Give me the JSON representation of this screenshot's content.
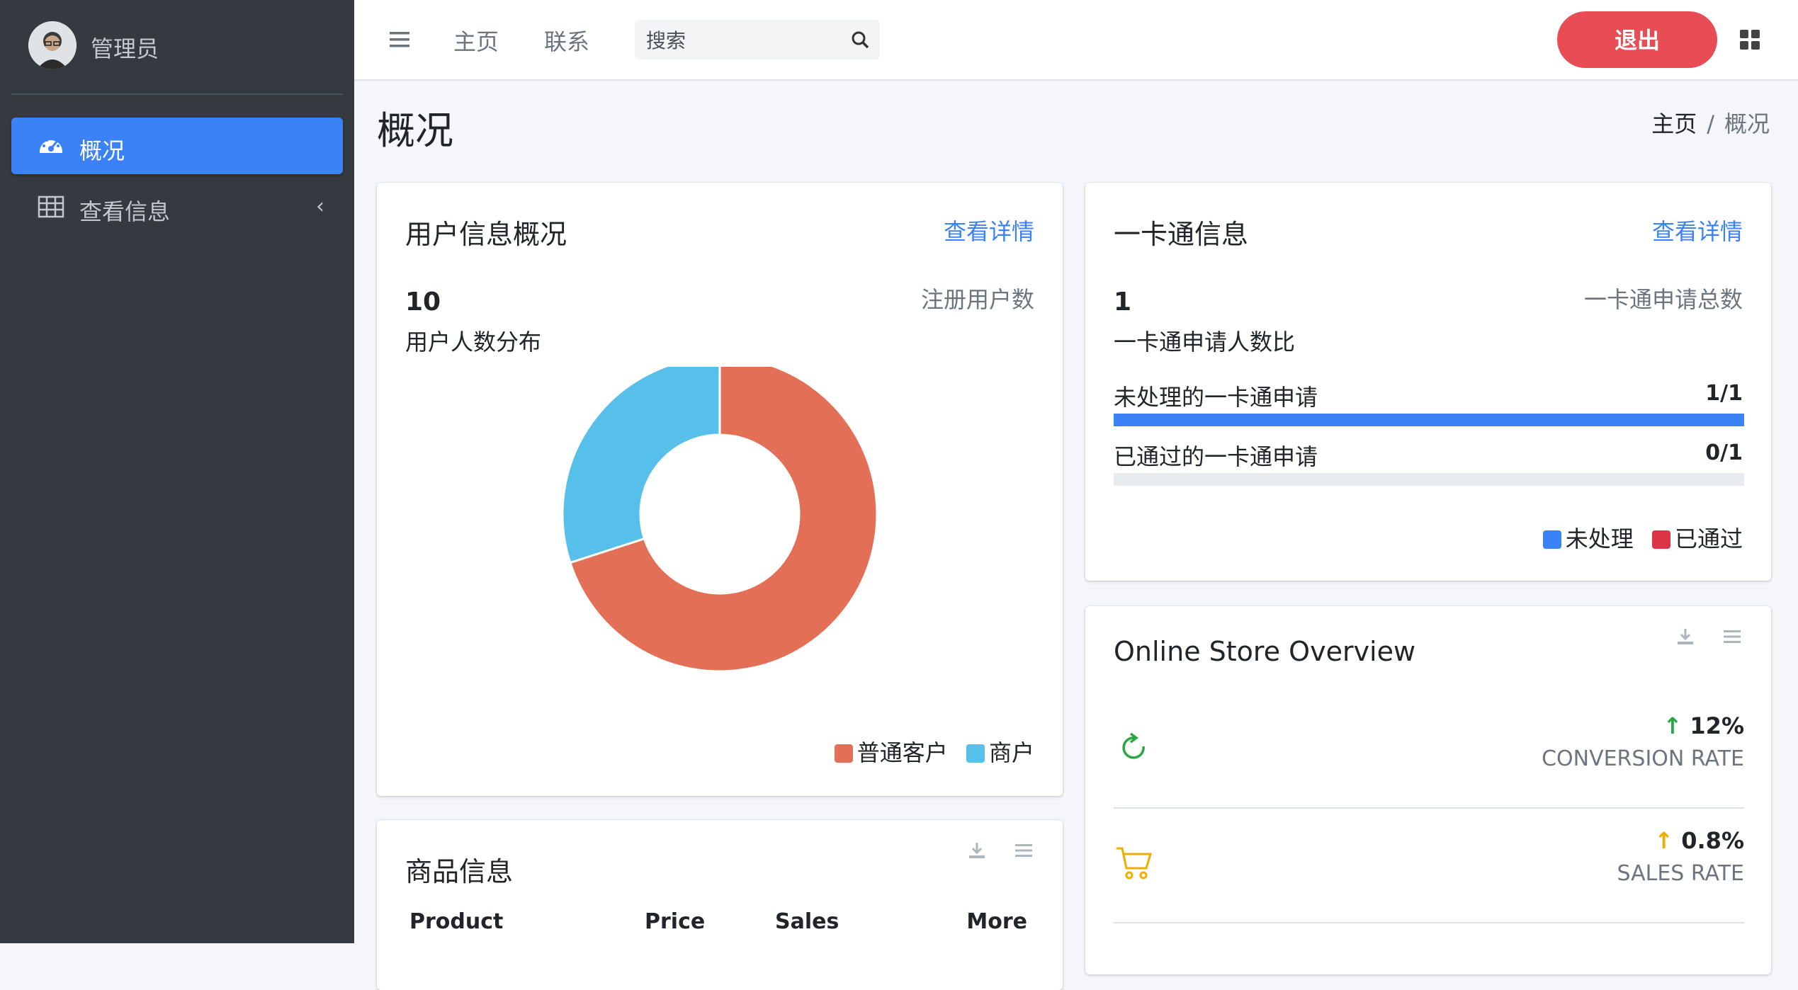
{
  "sidebar": {
    "user_name": "管理员",
    "items": [
      {
        "label": "概况",
        "icon": "dashboard-icon",
        "active": true
      },
      {
        "label": "查看信息",
        "icon": "table-icon",
        "active": false
      }
    ]
  },
  "navbar": {
    "links": [
      "主页",
      "联系"
    ],
    "search_placeholder": "搜索",
    "logout_label": "退出"
  },
  "page": {
    "title": "概况",
    "breadcrumb": [
      "主页",
      "概况"
    ]
  },
  "user_card": {
    "title": "用户信息概况",
    "link": "查看详情",
    "count": "10",
    "count_label": "注册用户数",
    "subtitle": "用户人数分布",
    "legend": [
      {
        "label": "普通客户",
        "color": "#e46f57"
      },
      {
        "label": "商户",
        "color": "#56bfea"
      }
    ]
  },
  "chart_data": {
    "type": "pie",
    "donut": true,
    "categories": [
      "普通客户",
      "商户"
    ],
    "values": [
      7,
      3
    ],
    "colors": [
      "#e46f57",
      "#56bfea"
    ],
    "title": "用户人数分布",
    "legend": "bottom-right"
  },
  "card_info": {
    "title": "一卡通信息",
    "link": "查看详情",
    "count": "1",
    "count_label": "一卡通申请总数",
    "subtitle": "一卡通申请人数比",
    "progress": [
      {
        "label": "未处理的一卡通申请",
        "value": "1/1",
        "fraction": 1.0,
        "color": "#3b82f6"
      },
      {
        "label": "已通过的一卡通申请",
        "value": "0/1",
        "fraction": 0.0,
        "color": "#dc3545"
      }
    ],
    "legend": [
      {
        "label": "未处理",
        "color": "#3b82f6"
      },
      {
        "label": "已通过",
        "color": "#dc3545"
      }
    ]
  },
  "store": {
    "title": "Online Store Overview",
    "rows": [
      {
        "value": "12%",
        "label": "CONVERSION RATE",
        "icon": "refresh-icon",
        "color": "#28a745"
      },
      {
        "value": "0.8%",
        "label": "SALES RATE",
        "icon": "cart-icon",
        "color": "#f0ad00"
      }
    ]
  },
  "products": {
    "title": "商品信息",
    "columns": [
      "Product",
      "Price",
      "Sales",
      "More"
    ]
  }
}
